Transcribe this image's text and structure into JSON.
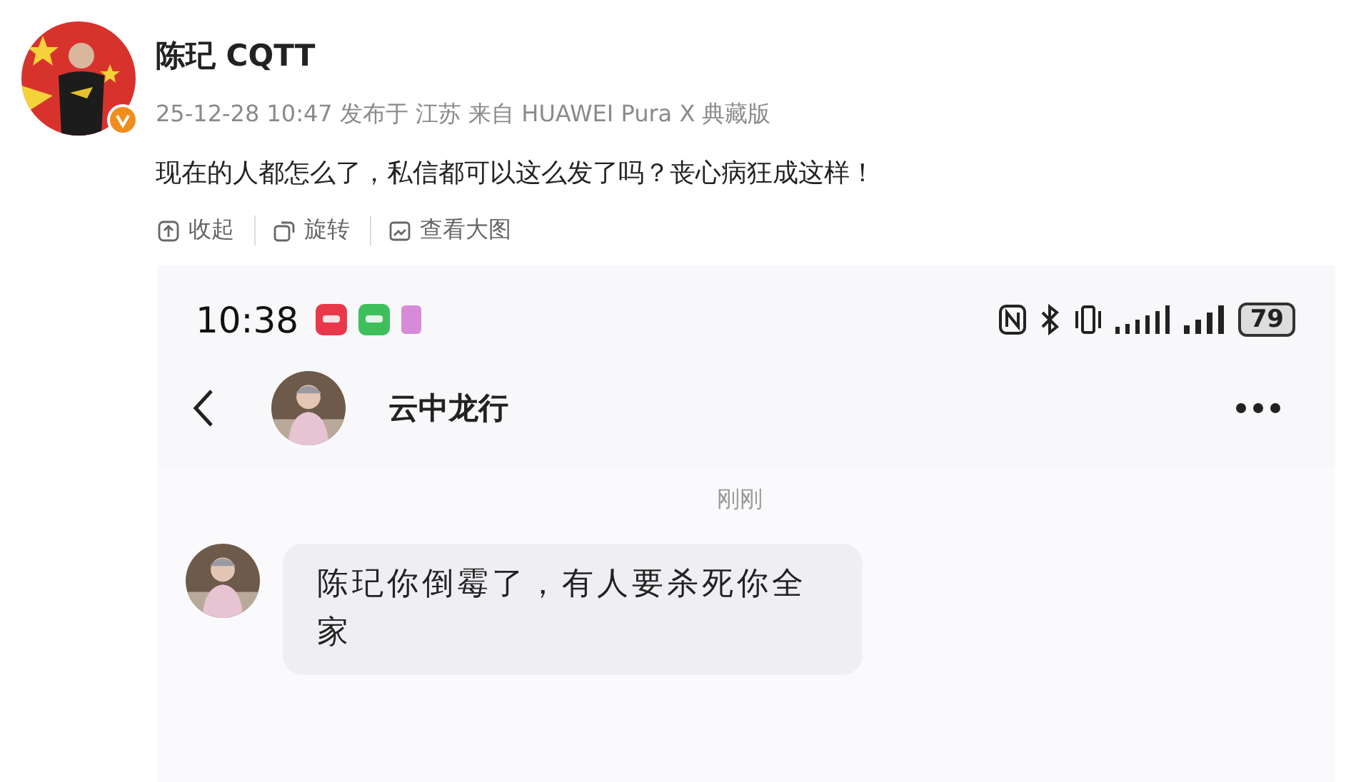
{
  "post": {
    "author": "陈玘 CQTT",
    "verified": true,
    "meta": "25-12-28 10:47 发布于 江苏 来自 HUAWEI Pura X 典藏版",
    "text": "现在的人都怎么了，私信都可以这么发了吗？丧心病狂成这样！",
    "actions": [
      {
        "kind": "collapse",
        "label": "收起"
      },
      {
        "kind": "rotate",
        "label": "旋转"
      },
      {
        "kind": "enlarge",
        "label": "查看大图"
      }
    ]
  },
  "screenshot": {
    "status_bar": {
      "time": "10:38",
      "battery": "79"
    },
    "chat": {
      "contact": "云中龙行",
      "timestamp": "刚刚",
      "messages": [
        {
          "text": "陈玘你倒霉了，有人要杀死你全家"
        }
      ]
    }
  }
}
